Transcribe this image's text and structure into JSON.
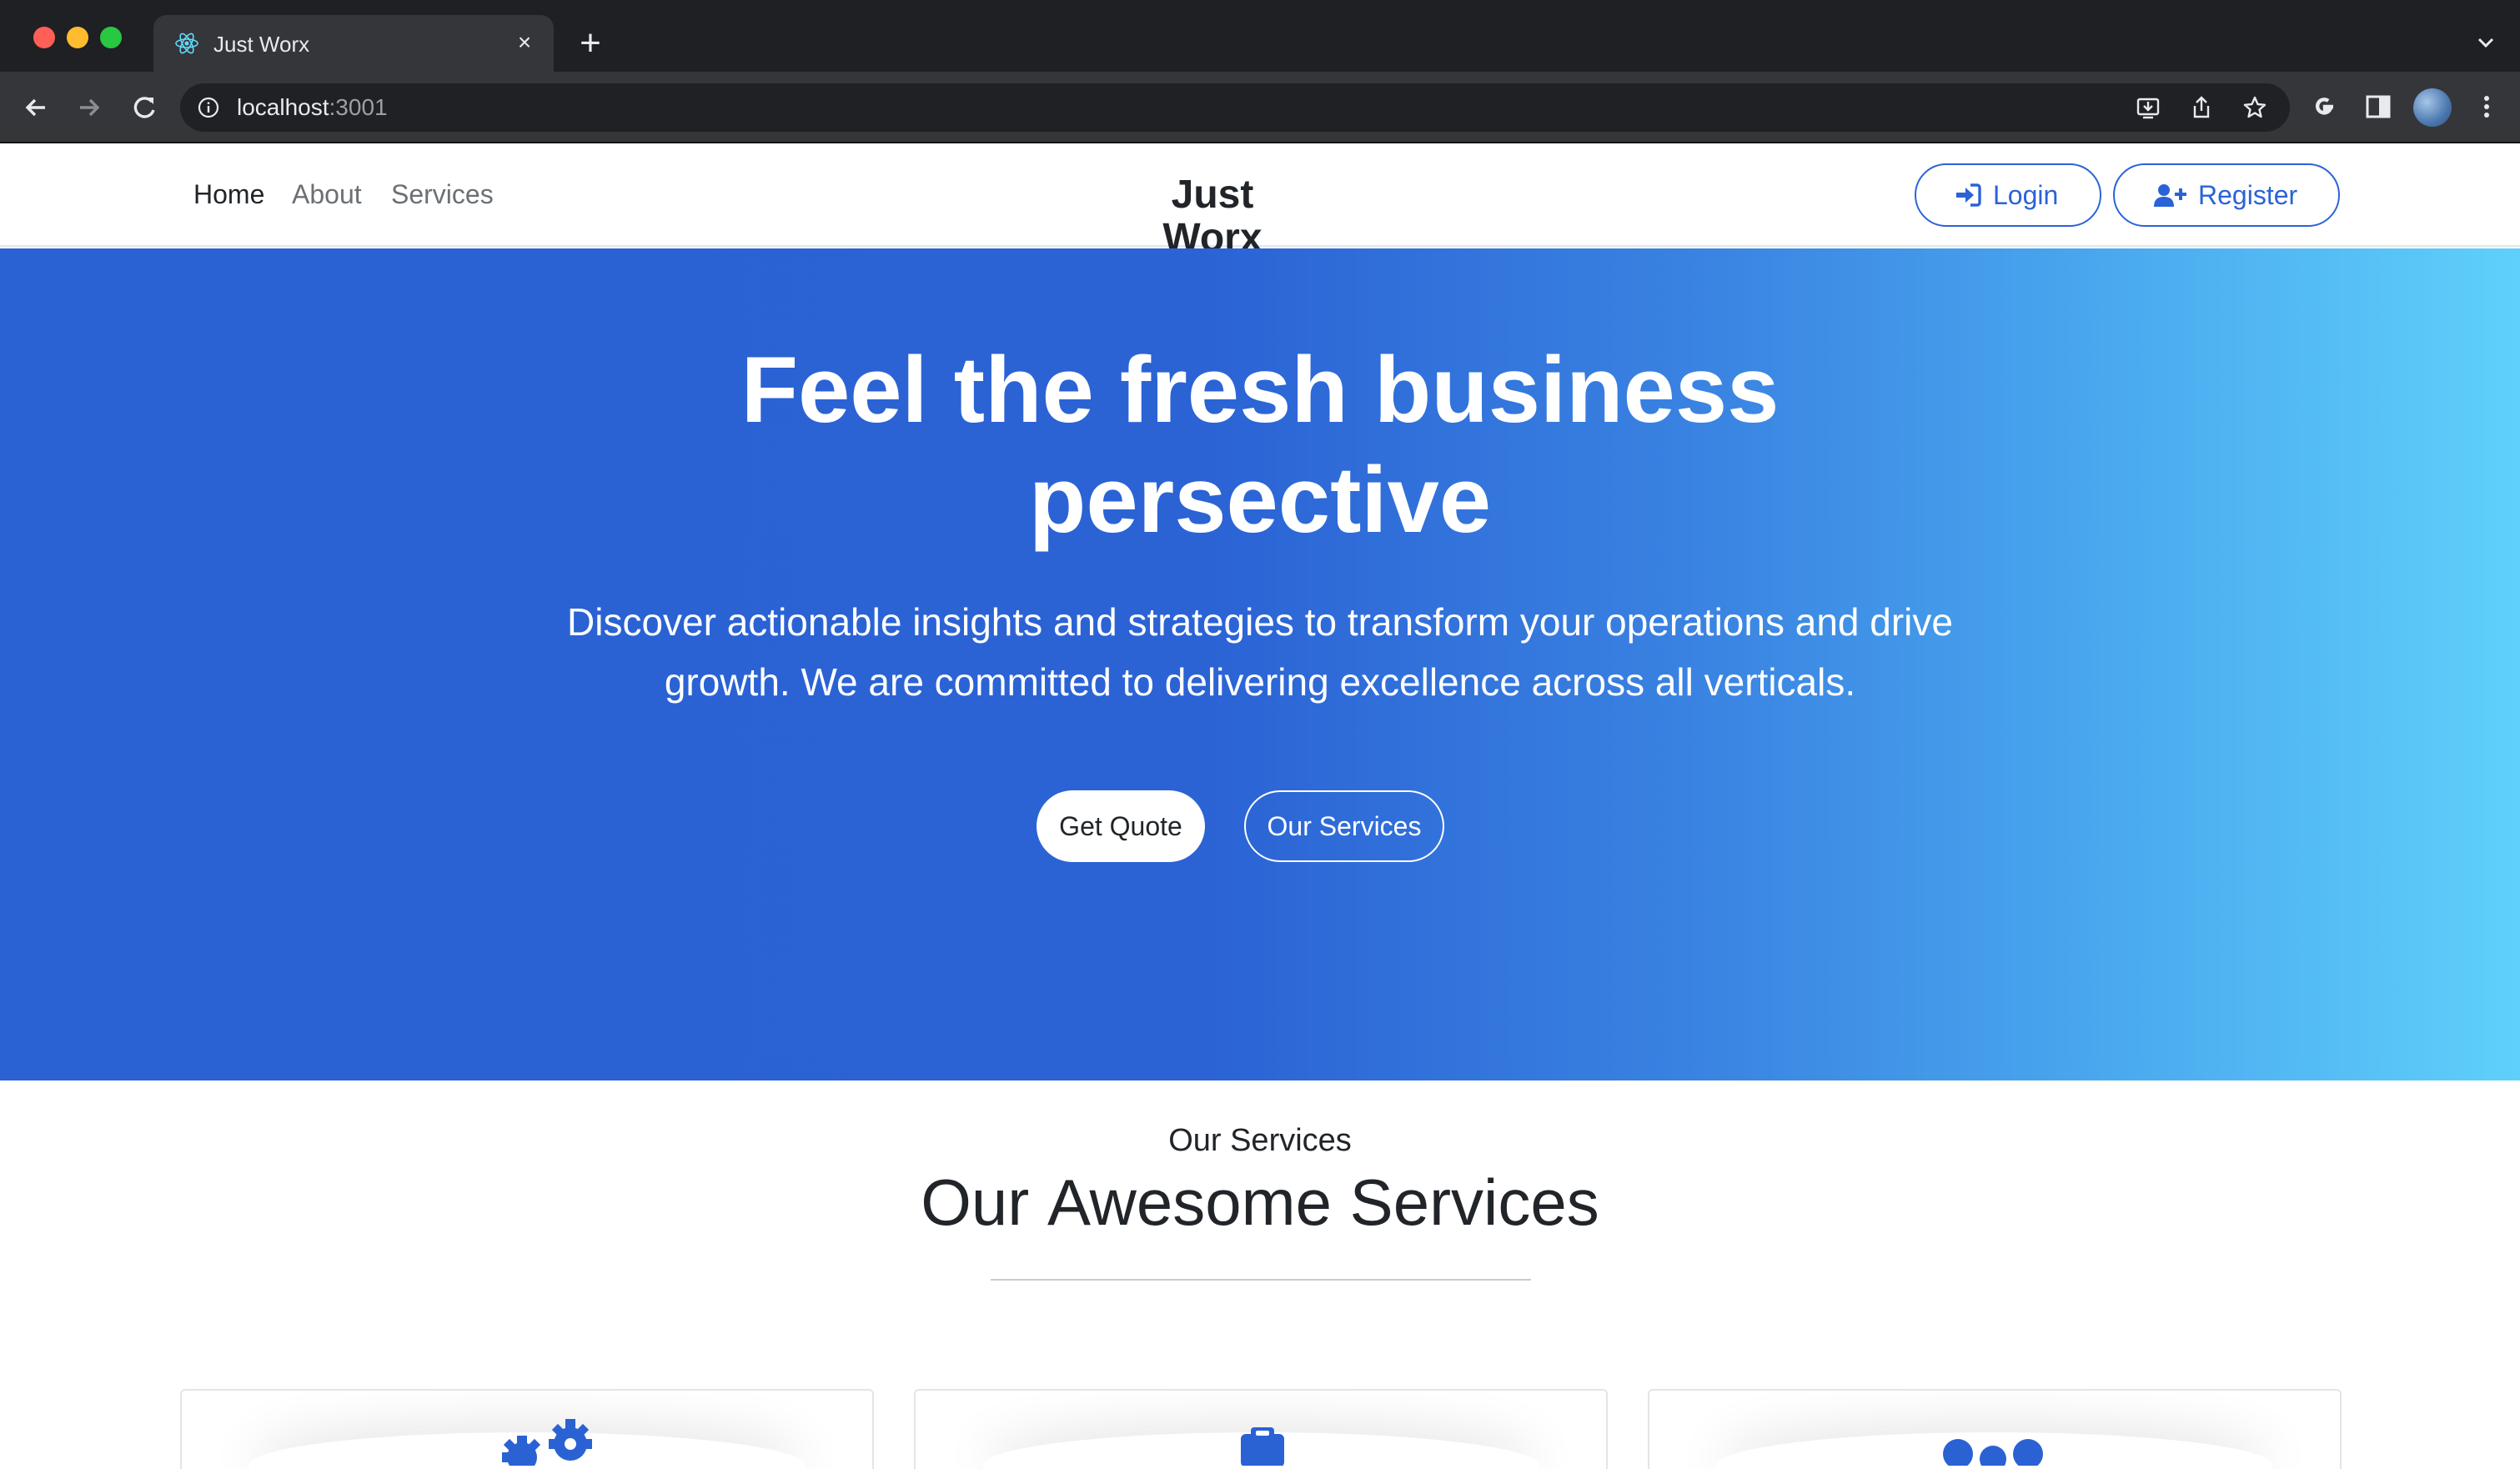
{
  "browser": {
    "tab_title": "Just Worx",
    "new_tab_symbol": "+",
    "close_symbol": "×",
    "url_host": "localhost",
    "url_port": ":3001"
  },
  "header": {
    "nav": [
      "Home",
      "About",
      "Services"
    ],
    "brand": "Just Worx",
    "login_label": "Login",
    "register_label": "Register"
  },
  "hero": {
    "title_line1": "Feel the fresh business",
    "title_line2": "persective",
    "subtitle_line1": "Discover actionable insights and strategies to transform your operations and drive",
    "subtitle_line2": "growth. We are committed to delivering excellence across all verticals.",
    "primary_button": "Get Quote",
    "secondary_button": "Our Services"
  },
  "services": {
    "eyebrow": "Our Services",
    "title_part1": "Our ",
    "title_part2": "Awesome",
    "title_part3": " Services",
    "cards": [
      {
        "icon": "gears-icon"
      },
      {
        "icon": "clipboard-icon"
      },
      {
        "icon": "users-icon"
      }
    ]
  },
  "colors": {
    "accent": "#2a63d7",
    "hero_start": "#2a62d4",
    "hero_end": "#5fd0fa"
  }
}
